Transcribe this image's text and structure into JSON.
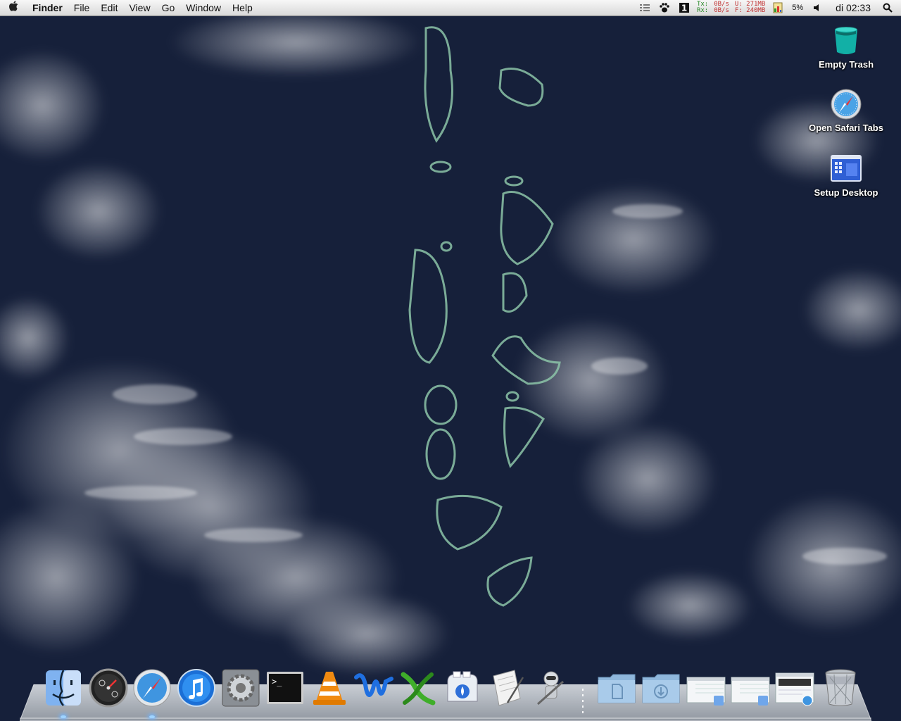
{
  "menubar": {
    "app_name": "Finder",
    "items": [
      "File",
      "Edit",
      "View",
      "Go",
      "Window",
      "Help"
    ],
    "network": {
      "tx_label": "Tx:",
      "rx_label": "Rx:",
      "tx_rate": "0B/s",
      "rx_rate": "0B/s",
      "used_label": "U: 271MB",
      "free_label": "F: 240MB"
    },
    "cpu_percent": "5%",
    "clock": "di 02:33",
    "icons": [
      "apple-icon",
      "list-icon",
      "paw-icon",
      "one-icon",
      "memory-icon",
      "volume-icon",
      "spotlight-icon"
    ]
  },
  "desktop": {
    "icons": [
      {
        "label": "Empty Trash",
        "icon": "trash-icon"
      },
      {
        "label": "Open Safari Tabs",
        "icon": "safari-compass-icon"
      },
      {
        "label": "Setup Desktop",
        "icon": "desktop-grid-icon"
      }
    ]
  },
  "dock": {
    "items": [
      {
        "name": "Finder",
        "icon": "finder-icon"
      },
      {
        "name": "Dashboard",
        "icon": "dashboard-icon"
      },
      {
        "name": "Safari",
        "icon": "safari-icon"
      },
      {
        "name": "iTunes",
        "icon": "itunes-icon"
      },
      {
        "name": "System Preferences",
        "icon": "system-preferences-icon"
      },
      {
        "name": "Terminal",
        "icon": "terminal-icon"
      },
      {
        "name": "VLC",
        "icon": "vlc-icon"
      },
      {
        "name": "Microsoft Word",
        "icon": "word-icon"
      },
      {
        "name": "Microsoft Excel",
        "icon": "excel-icon"
      },
      {
        "name": "Transmit",
        "icon": "toaster-icon"
      },
      {
        "name": "Script Editor",
        "icon": "script-editor-icon"
      },
      {
        "name": "Automator",
        "icon": "automator-icon"
      },
      {
        "name": "Documents",
        "icon": "documents-folder-icon"
      },
      {
        "name": "Downloads",
        "icon": "downloads-folder-icon"
      },
      {
        "name": "Window 1",
        "icon": "finder-window-icon"
      },
      {
        "name": "Window 2",
        "icon": "finder-window-icon"
      },
      {
        "name": "Window 3",
        "icon": "safari-window-icon"
      },
      {
        "name": "Trash",
        "icon": "trash-icon"
      }
    ]
  },
  "colors": {
    "ocean": "#17213a",
    "atoll": "#7fb8a0",
    "dock_indicator": "#9fd4ff"
  }
}
